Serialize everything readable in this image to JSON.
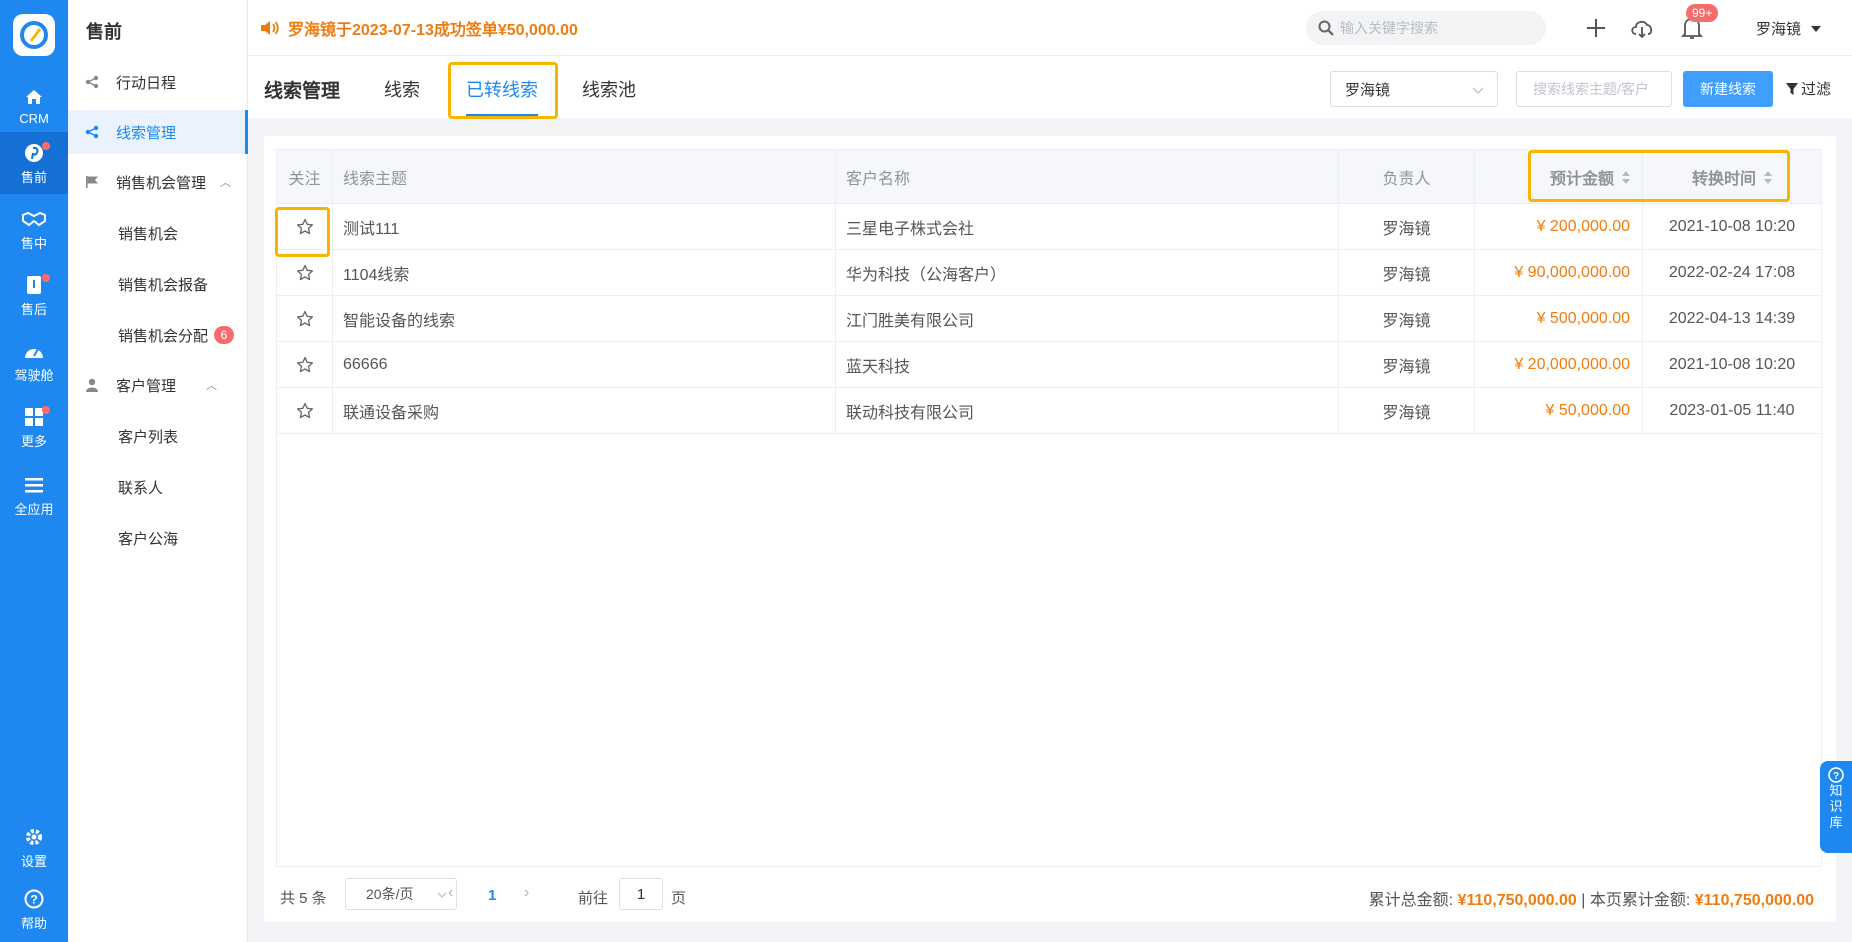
{
  "rail": {
    "items": [
      {
        "label": "CRM",
        "icon": "home-icon"
      },
      {
        "label": "售前",
        "icon": "pinterest-icon",
        "dot": true
      },
      {
        "label": "售中",
        "icon": "handshake-icon"
      },
      {
        "label": "售后",
        "icon": "box-icon",
        "dot": true
      },
      {
        "label": "驾驶舱",
        "icon": "dashboard-icon"
      },
      {
        "label": "更多",
        "icon": "grid-icon",
        "dot": true
      },
      {
        "label": "全应用",
        "icon": "menu-icon"
      },
      {
        "label": "设置",
        "icon": "gear-icon"
      },
      {
        "label": "帮助",
        "icon": "help-icon"
      }
    ]
  },
  "sidebar": {
    "title": "售前",
    "items": [
      {
        "label": "行动日程"
      },
      {
        "label": "线索管理"
      },
      {
        "label": "销售机会管理"
      },
      {
        "label": "销售机会"
      },
      {
        "label": "销售机会报备"
      },
      {
        "label": "销售机会分配",
        "badge": "6"
      },
      {
        "label": "客户管理"
      },
      {
        "label": "客户列表"
      },
      {
        "label": "联系人"
      },
      {
        "label": "客户公海"
      }
    ]
  },
  "topbar": {
    "notice": "罗海镜于2023-07-13成功签单¥50,000.00",
    "search_placeholder": "输入关键字搜索",
    "notif_badge": "99+",
    "user": "罗海镜"
  },
  "header": {
    "title": "线索管理",
    "tabs": [
      {
        "label": "线索"
      },
      {
        "label": "已转线索"
      },
      {
        "label": "线索池"
      }
    ],
    "owner_select": "罗海镜",
    "search_placeholder": "搜索线索主题/客户",
    "new_button": "新建线索",
    "filter": "过滤"
  },
  "table": {
    "columns": [
      "关注",
      "线索主题",
      "客户名称",
      "负责人",
      "预计金额",
      "转换时间"
    ],
    "rows": [
      {
        "subject": "测试111",
        "customer": "三星电子株式会社",
        "owner": "罗海镜",
        "amount": "¥ 200,000.00",
        "time": "2021-10-08 10:20"
      },
      {
        "subject": "1104线索",
        "customer": "华为科技（公海客户）",
        "owner": "罗海镜",
        "amount": "¥ 90,000,000.00",
        "time": "2022-02-24 17:08"
      },
      {
        "subject": "智能设备的线索",
        "customer": "江门胜美有限公司",
        "owner": "罗海镜",
        "amount": "¥ 500,000.00",
        "time": "2022-04-13 14:39"
      },
      {
        "subject": "66666",
        "customer": "蓝天科技",
        "owner": "罗海镜",
        "amount": "¥ 20,000,000.00",
        "time": "2021-10-08 10:20"
      },
      {
        "subject": "联通设备采购",
        "customer": "联动科技有限公司",
        "owner": "罗海镜",
        "amount": "¥ 50,000.00",
        "time": "2023-01-05 11:40"
      }
    ]
  },
  "pagination": {
    "total": "共 5 条",
    "page_size": "20条/页",
    "current": "1",
    "goto_label": "前往",
    "goto_value": "1",
    "page_label": "页"
  },
  "summary": {
    "total_label": "累计总金额:",
    "total_value": "¥110,750,000.00",
    "separator": "|",
    "page_label": "本页累计金额:",
    "page_value": "¥110,750,000.00"
  },
  "knowledge": {
    "label": [
      "知",
      "识",
      "库"
    ]
  },
  "colors": {
    "primary": "#1e88f0",
    "amount": "#f07c10",
    "highlight": "#f7b500",
    "badge": "#f56c6c"
  }
}
